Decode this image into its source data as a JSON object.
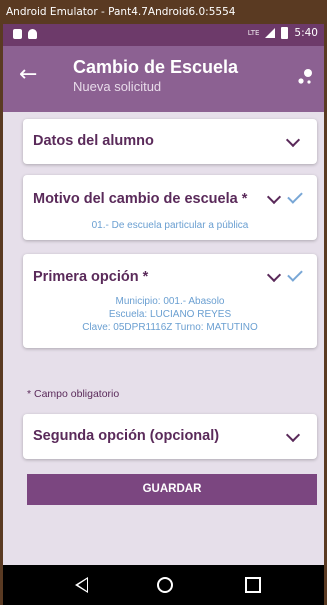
{
  "window": {
    "title": "Android Emulator - Pant4.7Android6.0:5554"
  },
  "status_bar": {
    "network": "LTE",
    "time": "5:40"
  },
  "app_bar": {
    "title": "Cambio de Escuela",
    "subtitle": "Nueva solicitud"
  },
  "sections": {
    "datos_alumno": {
      "label": "Datos del alumno"
    },
    "motivo": {
      "label": "Motivo del cambio de escuela *",
      "value": "01.- De escuela particular a pública"
    },
    "primera_opcion": {
      "label": "Primera opción *",
      "municipio": "Municipio: 001.- Abasolo",
      "escuela": "Escuela: LUCIANO REYES",
      "clave_turno": "Clave: 05DPR1116Z  Turno: MATUTINO"
    },
    "required_note": "* Campo obligatorio",
    "segunda_opcion": {
      "label": "Segunda opción (opcional)"
    }
  },
  "actions": {
    "save_label": "GUARDAR"
  },
  "colors": {
    "primary": "#8c6192",
    "primary_dark": "#6d3a6a",
    "accent_text": "#6a9fd1",
    "button": "#7b4680"
  }
}
